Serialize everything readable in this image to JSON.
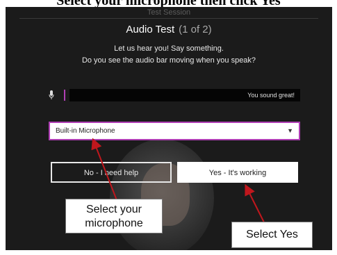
{
  "caption": "Select your microphone then click Yes",
  "dialog": {
    "session_label": "Test Session",
    "title": "Audio Test",
    "step": "(1 of 2)",
    "instruction_line1": "Let us hear you! Say something.",
    "instruction_line2": "Do you see the audio bar moving when you speak?"
  },
  "audio_level": {
    "status_text": "You sound great!",
    "accent_color": "#b03fb5"
  },
  "microphone_select": {
    "selected": "Built-in Microphone"
  },
  "buttons": {
    "no_label": "No - I need help",
    "yes_label": "Yes - It's working"
  },
  "annotations": {
    "mic_callout_line1": "Select your",
    "mic_callout_line2": "microphone",
    "yes_callout": "Select Yes",
    "arrow_color": "#c0171d"
  },
  "icons": {
    "mic": "microphone-icon",
    "dropdown": "chevron-down-icon"
  }
}
